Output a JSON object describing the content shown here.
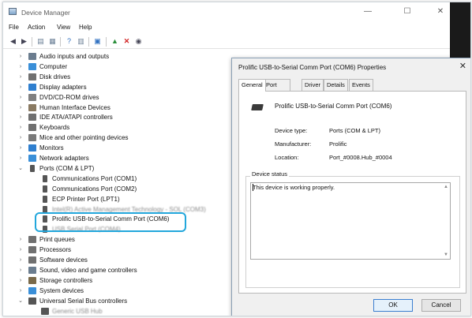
{
  "window": {
    "title": "Device Manager",
    "controls": [
      "—",
      "☐",
      "✕"
    ]
  },
  "menu": [
    "File",
    "Action",
    "View",
    "Help"
  ],
  "tree": [
    {
      "label": "Audio inputs and outputs",
      "level": 1,
      "expanded": false,
      "icon": "speaker-icon",
      "color": "#6b7d8f"
    },
    {
      "label": "Computer",
      "level": 1,
      "expanded": false,
      "icon": "computer-icon",
      "color": "#3a8fd8"
    },
    {
      "label": "Disk drives",
      "level": 1,
      "expanded": false,
      "icon": "disk-drive-icon",
      "color": "#707070"
    },
    {
      "label": "Display adapters",
      "level": 1,
      "expanded": false,
      "icon": "display-adapter-icon",
      "color": "#2f7fcf"
    },
    {
      "label": "DVD/CD-ROM drives",
      "level": 1,
      "expanded": false,
      "icon": "dvd-drive-icon",
      "color": "#808080"
    },
    {
      "label": "Human Interface Devices",
      "level": 1,
      "expanded": false,
      "icon": "hid-icon",
      "color": "#8a7a62"
    },
    {
      "label": "IDE ATA/ATAPI controllers",
      "level": 1,
      "expanded": false,
      "icon": "ide-controller-icon",
      "color": "#6f6f6f"
    },
    {
      "label": "Keyboards",
      "level": 1,
      "expanded": false,
      "icon": "keyboard-icon",
      "color": "#707070"
    },
    {
      "label": "Mice and other pointing devices",
      "level": 1,
      "expanded": false,
      "icon": "mouse-icon",
      "color": "#7a7a7a"
    },
    {
      "label": "Monitors",
      "level": 1,
      "expanded": false,
      "icon": "monitor-icon",
      "color": "#2f7fcf"
    },
    {
      "label": "Network adapters",
      "level": 1,
      "expanded": false,
      "icon": "network-adapter-icon",
      "color": "#3a8fd8"
    },
    {
      "label": "Ports (COM & LPT)",
      "level": 1,
      "expanded": true,
      "icon": "port-icon",
      "color": "#555555"
    },
    {
      "label": "Communications Port (COM1)",
      "level": 2,
      "icon": "port-icon",
      "color": "#555555"
    },
    {
      "label": "Communications Port (COM2)",
      "level": 2,
      "icon": "port-icon",
      "color": "#555555"
    },
    {
      "label": "ECP Printer Port (LPT1)",
      "level": 2,
      "icon": "port-icon",
      "color": "#555555"
    },
    {
      "label": "Intel(R) Active Management Technology - SOL (COM3)",
      "level": 2,
      "icon": "port-icon",
      "color": "#555555",
      "obscured": true
    },
    {
      "label": "Prolific USB-to-Serial Comm Port (COM6)",
      "level": 2,
      "icon": "port-icon",
      "color": "#555555",
      "selected": true
    },
    {
      "label": "USB Serial Port (COM4)",
      "level": 2,
      "icon": "port-icon",
      "color": "#555555",
      "obscured": true
    },
    {
      "label": "Print queues",
      "level": 1,
      "expanded": false,
      "icon": "printer-icon",
      "color": "#707070"
    },
    {
      "label": "Processors",
      "level": 1,
      "expanded": false,
      "icon": "processor-icon",
      "color": "#707070"
    },
    {
      "label": "Software devices",
      "level": 1,
      "expanded": false,
      "icon": "software-device-icon",
      "color": "#707070"
    },
    {
      "label": "Sound, video and game controllers",
      "level": 1,
      "expanded": false,
      "icon": "sound-controller-icon",
      "color": "#6b7d8f"
    },
    {
      "label": "Storage controllers",
      "level": 1,
      "expanded": false,
      "icon": "storage-controller-icon",
      "color": "#7a6a4a"
    },
    {
      "label": "System devices",
      "level": 1,
      "expanded": false,
      "icon": "system-device-icon",
      "color": "#3a8fd8"
    },
    {
      "label": "Universal Serial Bus controllers",
      "level": 1,
      "expanded": true,
      "icon": "usb-icon",
      "color": "#555555"
    },
    {
      "label": "Generic USB Hub",
      "level": 2,
      "icon": "usb-icon",
      "color": "#555555",
      "obscured": true
    }
  ],
  "dialog": {
    "title": "Prolific USB-to-Serial Comm Port (COM6) Properties",
    "close_icon": "✕",
    "tabs": [
      "General",
      "Port Settings",
      "Driver",
      "Details",
      "Events"
    ],
    "active_tab": "General",
    "device_name": "Prolific USB-to-Serial Comm Port (COM6)",
    "props": [
      {
        "label": "Device type:",
        "value": "Ports (COM & LPT)"
      },
      {
        "label": "Manufacturer:",
        "value": "Prolific"
      },
      {
        "label": "Location:",
        "value": "Port_#0008.Hub_#0004"
      }
    ],
    "status_group": "Device status",
    "status_text": "This device is working properly.",
    "ok": "OK",
    "cancel": "Cancel"
  },
  "colors": {
    "highlight": "#23a7dc",
    "ok_border": "#3c7fd0"
  }
}
